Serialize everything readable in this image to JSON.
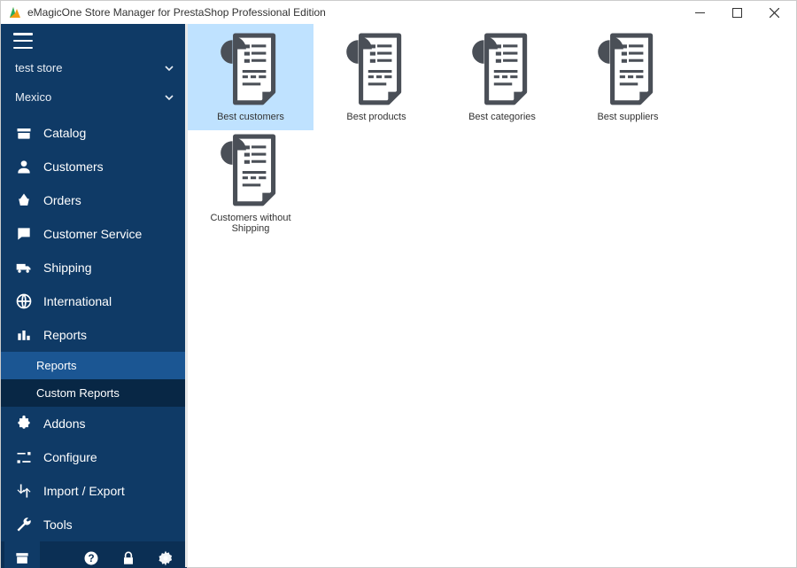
{
  "window": {
    "title": "eMagicOne Store Manager for PrestaShop Professional Edition"
  },
  "store": {
    "name": "test store",
    "subtext": "",
    "country": "Mexico"
  },
  "sidebar": {
    "items": [
      {
        "key": "catalog",
        "label": "Catalog"
      },
      {
        "key": "customers",
        "label": "Customers"
      },
      {
        "key": "orders",
        "label": "Orders"
      },
      {
        "key": "customer-service",
        "label": "Customer Service"
      },
      {
        "key": "shipping",
        "label": "Shipping"
      },
      {
        "key": "international",
        "label": "International"
      },
      {
        "key": "reports",
        "label": "Reports"
      },
      {
        "key": "addons",
        "label": "Addons"
      },
      {
        "key": "configure",
        "label": "Configure"
      },
      {
        "key": "import-export",
        "label": "Import / Export"
      },
      {
        "key": "tools",
        "label": "Tools"
      }
    ],
    "reports_sub": [
      {
        "label": "Reports",
        "selected": true
      },
      {
        "label": "Custom Reports",
        "selected": false
      }
    ]
  },
  "reports": [
    {
      "key": "best-customers",
      "label": "Best customers",
      "selected": true
    },
    {
      "key": "best-products",
      "label": "Best products",
      "selected": false
    },
    {
      "key": "best-categories",
      "label": "Best categories",
      "selected": false
    },
    {
      "key": "best-suppliers",
      "label": "Best suppliers",
      "selected": false
    },
    {
      "key": "customers-without-shipping",
      "label": "Customers without Shipping",
      "selected": false
    }
  ]
}
